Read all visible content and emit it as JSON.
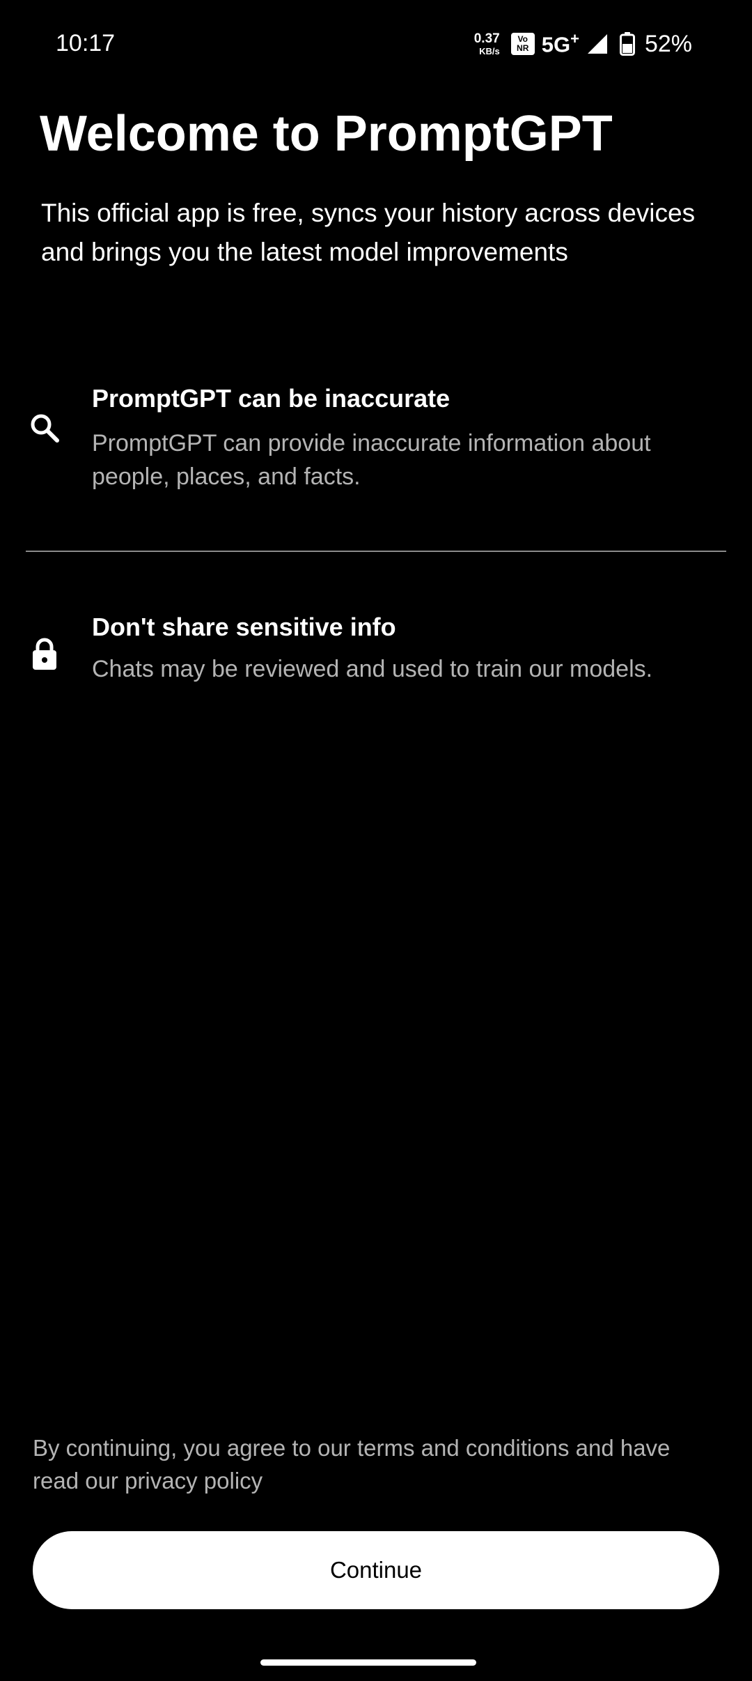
{
  "status_bar": {
    "time": "10:17",
    "net_speed_value": "0.37",
    "net_speed_unit": "KB/s",
    "vonr_top": "Vo",
    "vonr_bottom": "NR",
    "network_type": "5G",
    "network_type_suffix": "+",
    "battery_percent": "52%",
    "icons": [
      "signal-icon",
      "battery-icon"
    ]
  },
  "header": {
    "title": "Welcome to PromptGPT",
    "subtitle": "This official app is free, syncs your history across devices and brings you the latest model improvements"
  },
  "features": [
    {
      "icon": "search-icon",
      "title": "PromptGPT can be inaccurate",
      "description": "PromptGPT can provide inaccurate information about people, places, and facts."
    },
    {
      "icon": "lock-icon",
      "title": "Don't share sensitive info",
      "description": "Chats may be reviewed and used to train our models."
    }
  ],
  "footer": {
    "terms_text": "By continuing, you agree to our terms and conditions and have read our privacy policy",
    "continue_label": "Continue"
  },
  "colors": {
    "background": "#000000",
    "primary_text": "#ffffff",
    "secondary_text": "#b4b4b4",
    "button_background": "#ffffff",
    "button_text": "#000000",
    "divider": "#8a8a8a"
  }
}
